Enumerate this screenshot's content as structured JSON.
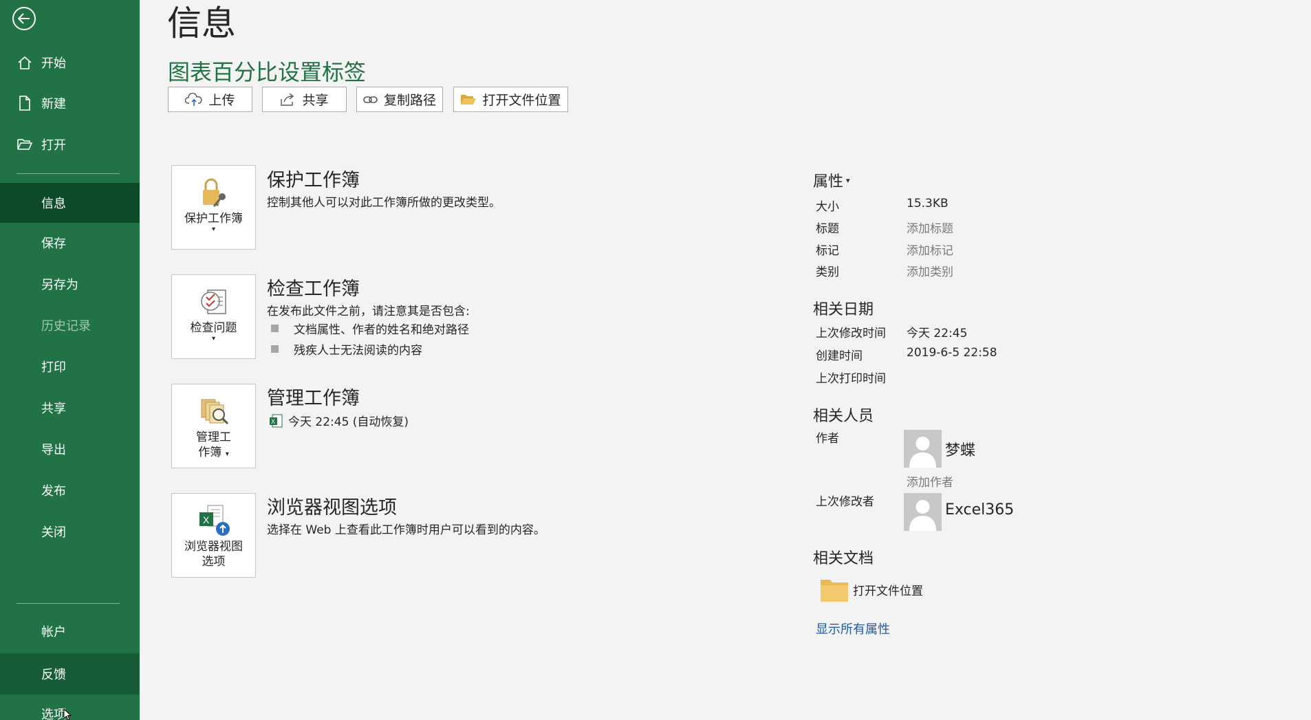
{
  "sidebar": {
    "items": [
      {
        "label": "开始"
      },
      {
        "label": "新建"
      },
      {
        "label": "打开"
      },
      {
        "label": "信息"
      },
      {
        "label": "保存"
      },
      {
        "label": "另存为"
      },
      {
        "label": "历史记录"
      },
      {
        "label": "打印"
      },
      {
        "label": "共享"
      },
      {
        "label": "导出"
      },
      {
        "label": "发布"
      },
      {
        "label": "关闭"
      },
      {
        "label": "帐户"
      },
      {
        "label": "反馈"
      },
      {
        "label": "选项"
      }
    ],
    "selected": "信息",
    "disabled": "历史记录"
  },
  "page": {
    "title": "信息",
    "doc_title": "图表百分比设置标签"
  },
  "toolbar": {
    "upload": "上传",
    "share": "共享",
    "copy_path": "复制路径",
    "open_location": "打开文件位置"
  },
  "sections": {
    "protect": {
      "tile_label": "保护工作簿",
      "heading": "保护工作簿",
      "desc": "控制其他人可以对此工作簿所做的更改类型。"
    },
    "inspect": {
      "tile_label": "检查问题",
      "heading": "检查工作簿",
      "desc": "在发布此文件之前，请注意其是否包含:",
      "bullets": [
        "文档属性、作者的姓名和绝对路径",
        "残疾人士无法阅读的内容"
      ]
    },
    "manage": {
      "tile_label_1": "管理工",
      "tile_label_2": "作簿",
      "heading": "管理工作簿",
      "version": "今天 22:45 (自动恢复)"
    },
    "browser": {
      "tile_label_1": "浏览器视图",
      "tile_label_2": "选项",
      "heading": "浏览器视图选项",
      "desc": "选择在 Web 上查看此工作簿时用户可以看到的内容。"
    }
  },
  "properties": {
    "heading": "属性",
    "size_label": "大小",
    "size_value": "15.3KB",
    "title_label": "标题",
    "title_placeholder": "添加标题",
    "tags_label": "标记",
    "tags_placeholder": "添加标记",
    "category_label": "类别",
    "category_placeholder": "添加类别"
  },
  "dates": {
    "heading": "相关日期",
    "modified_label": "上次修改时间",
    "modified_value": "今天 22:45",
    "created_label": "创建时间",
    "created_value": "2019-6-5 22:58",
    "printed_label": "上次打印时间"
  },
  "people": {
    "heading": "相关人员",
    "author_label": "作者",
    "author_name": "梦蝶",
    "add_author": "添加作者",
    "modified_by_label": "上次修改者",
    "modified_by_name": "Excel365"
  },
  "related_docs": {
    "heading": "相关文档",
    "open_location": "打开文件位置"
  },
  "show_all": "显示所有属性",
  "colors": {
    "sidebar": "#217346",
    "sidebar_selected": "#0e4a28",
    "doc_title": "#217346",
    "link": "#1e5aa8"
  }
}
